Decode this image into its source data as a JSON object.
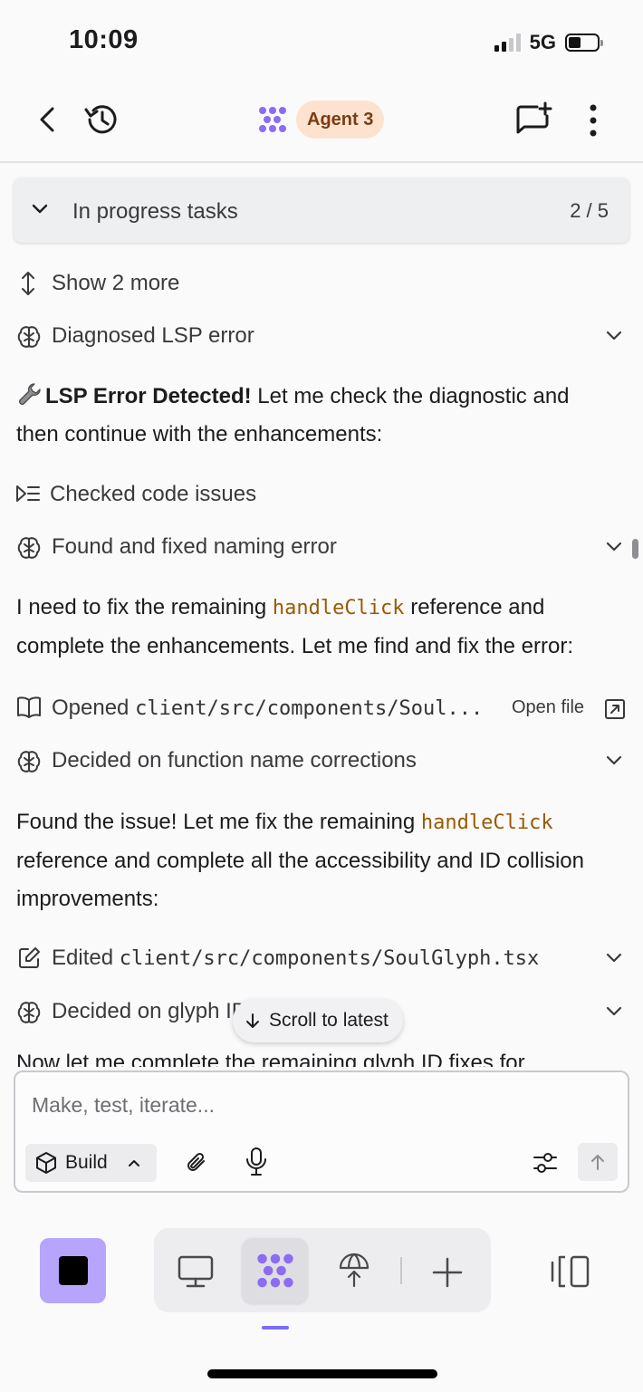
{
  "status_bar": {
    "time": "10:09",
    "network": "5G"
  },
  "header": {
    "agent_label": "Agent 3"
  },
  "tasks": {
    "title": "In progress tasks",
    "count": "2 / 5"
  },
  "feed": {
    "show_more": "Show 2 more",
    "item_diagnosed": "Diagnosed LSP error",
    "msg1_strong": "LSP Error Detected!",
    "msg1_rest": " Let me check the diagnostic and then continue with the enhancements:",
    "item_checked": "Checked code issues",
    "item_found_fixed": "Found and fixed naming error",
    "msg2_pre": "I need to fix the remaining ",
    "msg2_code": "handleClick",
    "msg2_post": " reference and complete the enhancements. Let me find and fix the error:",
    "opened_label": "Opened ",
    "opened_path": "client/src/components/Soul...",
    "open_file": "Open file",
    "item_decided_fn": "Decided on function name corrections",
    "msg3_pre": "Found the issue! Let me fix the remaining ",
    "msg3_code": "handleClick",
    "msg3_post": " reference and complete all the accessibility and ID collision improvements:",
    "edited_label": "Edited ",
    "edited_path": "client/src/components/SoulGlyph.tsx",
    "item_decided_glyph": "Decided on glyph ID",
    "cutoff_text": "Now let me complete the remaining glyph ID fixes for"
  },
  "scroll_latest": "Scroll to latest",
  "composer": {
    "placeholder": "Make, test, iterate...",
    "mode_label": "Build"
  },
  "colors": {
    "accent": "#7c6cf5",
    "stop_button": "#b7a4fb",
    "agent_badge_bg": "#fde3cf",
    "code_highlight": "#9a5a00"
  }
}
